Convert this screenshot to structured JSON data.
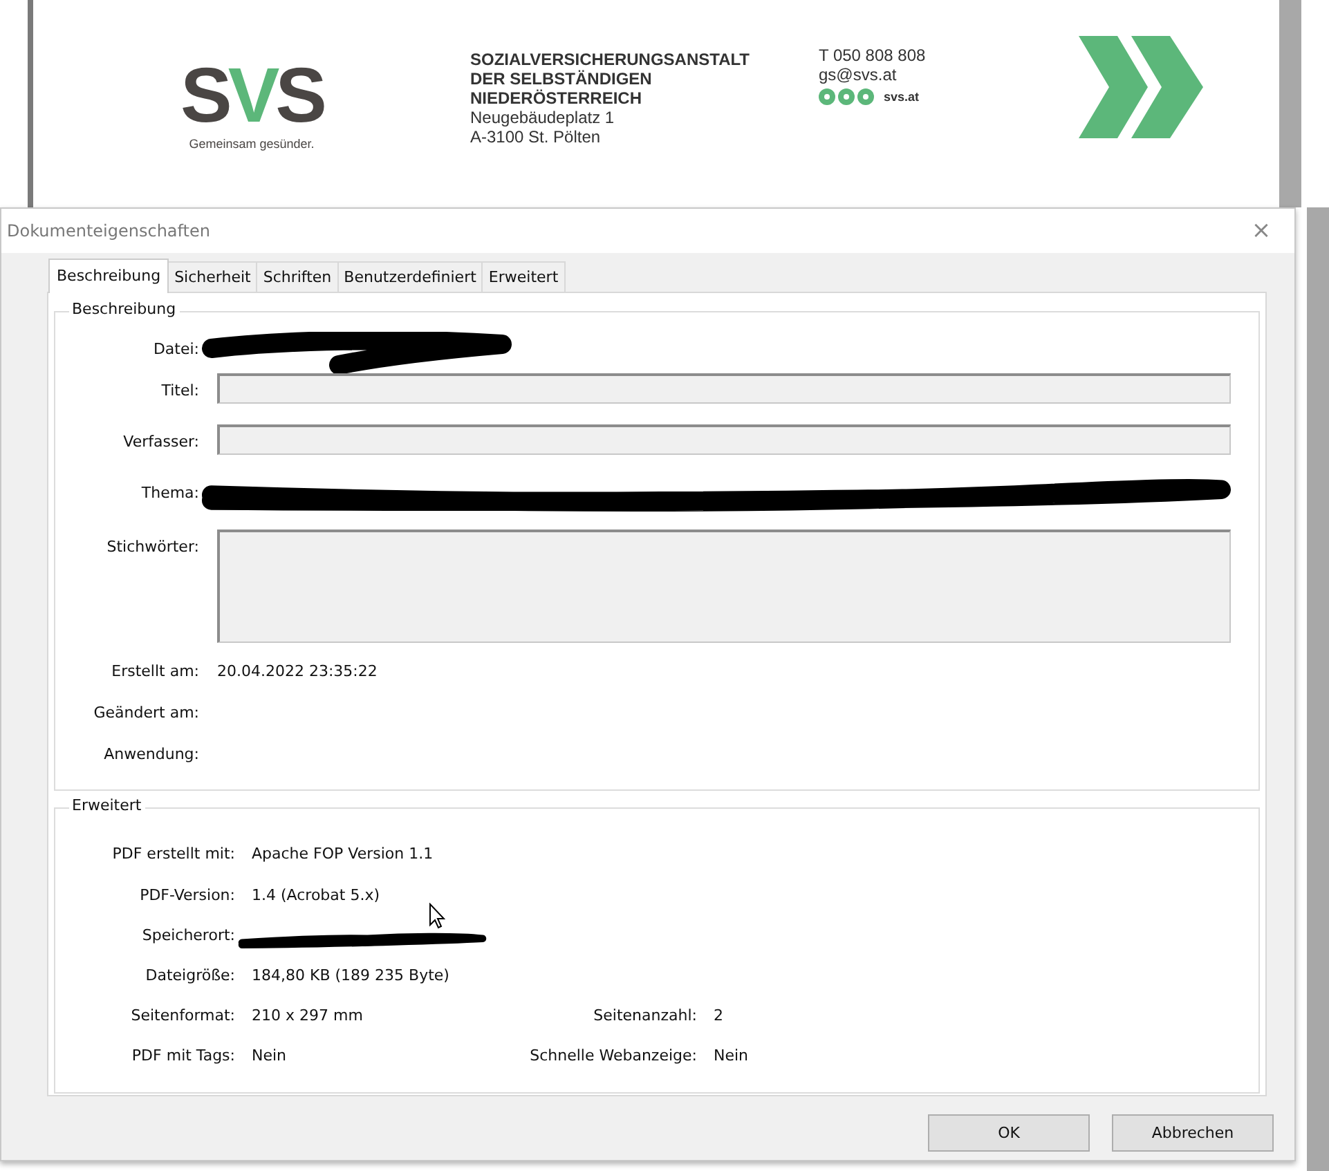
{
  "letterhead": {
    "logo_letters": [
      "S",
      "V",
      "S"
    ],
    "tagline": "Gemeinsam gesünder.",
    "address": [
      {
        "text": "SOZIALVERSICHERUNGSANSTALT",
        "bold": true
      },
      {
        "text": "DER SELBSTÄNDIGEN",
        "bold": true
      },
      {
        "text": "NIEDERÖSTERREICH",
        "bold": true
      },
      {
        "text": "Neugebäudeplatz 1",
        "bold": false
      },
      {
        "text": "A-3100 St. Pölten",
        "bold": false
      }
    ],
    "contact": {
      "phone": "T  050 808 808",
      "email": "gs@svs.at",
      "web": "svs.at"
    }
  },
  "dialog": {
    "title": "Dokumenteigenschaften",
    "close": "×",
    "tabs": [
      {
        "label": "Beschreibung",
        "selected": true
      },
      {
        "label": "Sicherheit",
        "selected": false
      },
      {
        "label": "Schriften",
        "selected": false
      },
      {
        "label": "Benutzerdefiniert",
        "selected": false
      },
      {
        "label": "Erweitert",
        "selected": false
      }
    ],
    "description": {
      "title": "Beschreibung",
      "rows": [
        {
          "label": "Datei:",
          "kind": "redacted"
        },
        {
          "label": "Titel:",
          "kind": "field"
        },
        {
          "label": "Verfasser:",
          "kind": "field"
        },
        {
          "label": "Thema:",
          "kind": "redacted"
        },
        {
          "label": "Stichwörter:",
          "kind": "area"
        },
        {
          "label": "Erstellt am:",
          "kind": "text",
          "value": "20.04.2022 23:35:22"
        },
        {
          "label": "Geändert am:",
          "kind": "text"
        },
        {
          "label": "Anwendung:",
          "kind": "text"
        }
      ]
    },
    "advanced": {
      "title": "Erweitert",
      "rows": [
        [
          {
            "label": "PDF erstellt mit:",
            "kind": "text",
            "value": "Apache FOP Version 1.1"
          }
        ],
        [
          {
            "label": "PDF-Version:",
            "kind": "text",
            "value": "1.4 (Acrobat 5.x)"
          }
        ],
        [
          {
            "label": "Speicherort:",
            "kind": "redacted"
          }
        ],
        [
          {
            "label": "Dateigröße:",
            "kind": "text",
            "value": "184,80 KB (189 235 Byte)"
          }
        ],
        [
          {
            "label": "Seitenformat:",
            "kind": "text",
            "value": "210 x 297 mm"
          },
          {
            "label": "Seitenanzahl:",
            "kind": "text",
            "value": "2"
          }
        ],
        [
          {
            "label": "PDF mit Tags:",
            "kind": "text",
            "value": "Nein"
          },
          {
            "label": "Schnelle Webanzeige:",
            "kind": "text",
            "value": "Nein"
          }
        ]
      ]
    },
    "buttons": [
      "OK",
      "Abbrechen"
    ]
  }
}
